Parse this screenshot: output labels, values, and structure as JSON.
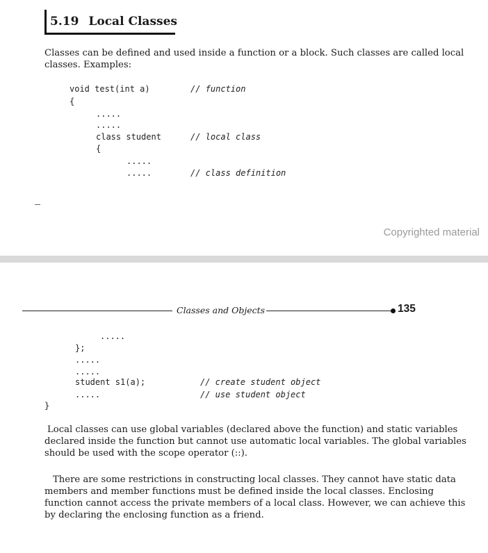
{
  "section": {
    "number": "5.19",
    "title": "Local Classes"
  },
  "intro_text": "Classes can be defined and used inside a function or a block. Such classes are called local classes. Examples:",
  "code_top": {
    "line1": "void test(int a)",
    "line1_comment": "// function",
    "line2": "{",
    "line3": ".....",
    "line4": ".....",
    "line5": "class student",
    "line5_comment": "// local class",
    "line6": "{",
    "line7": ".....",
    "line8": ".....",
    "line8_comment": "// class definition"
  },
  "copyright": "Copyrighted material",
  "running_head": {
    "text": "Classes and Objects",
    "page_number": "135"
  },
  "code_bottom": {
    "line1": ".....",
    "line2": "};",
    "line3": ".....",
    "line4": ".....",
    "line5": "student s1(a);",
    "line5_comment": "// create student object",
    "line6": ".....",
    "line6_comment": "// use student object",
    "line7": "}"
  },
  "para_globals": "Local classes can use global variables (declared above the function) and static variables declared inside the function but cannot use automatic local variables. The global variables should be used with the scope operator (::).",
  "para_restrictions": "There are some restrictions in constructing local classes. They cannot have static data members and member functions must be defined inside the local classes. Enclosing function cannot access the private members of a local class. However, we can achieve this by declaring the enclosing function as a friend."
}
